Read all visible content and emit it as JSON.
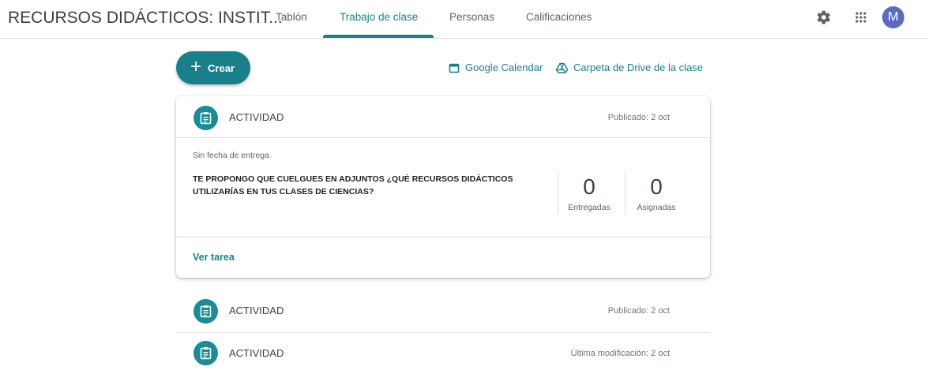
{
  "header": {
    "class_title": "RECURSOS DIDÁCTICOS: INSTIT...",
    "tabs": [
      "Tablón",
      "Trabajo de clase",
      "Personas",
      "Calificaciones"
    ],
    "active_tab": "Trabajo de clase",
    "avatar_letter": "M",
    "icons": [
      "gear-icon",
      "apps-grid-icon"
    ]
  },
  "toolbar": {
    "create_label": "Crear",
    "calendar_label": "Google Calendar",
    "drive_label": "Carpeta de Drive de la clase"
  },
  "items": [
    {
      "title": "ACTIVIDAD",
      "date": "Publicado: 2 oct",
      "expanded": true,
      "due": "Sin fecha de entrega",
      "instructions": "TE PROPONGO QUE CUELGUES EN ADJUNTOS ¿QUÉ RECURSOS DIDÁCTICOS UTILIZARÍAS EN TUS CLASES DE CIENCIAS?",
      "turned_in": {
        "value": "0",
        "label": "Entregadas"
      },
      "assigned": {
        "value": "0",
        "label": "Asignadas"
      },
      "view_label": "Ver tarea"
    },
    {
      "title": "ACTIVIDAD",
      "date": "Publicado: 2 oct"
    },
    {
      "title": "ACTIVIDAD",
      "date": "Última modificación: 2 oct"
    }
  ],
  "colors": {
    "accent": "#1a7f8a",
    "avatar": "#5c6bc0"
  }
}
